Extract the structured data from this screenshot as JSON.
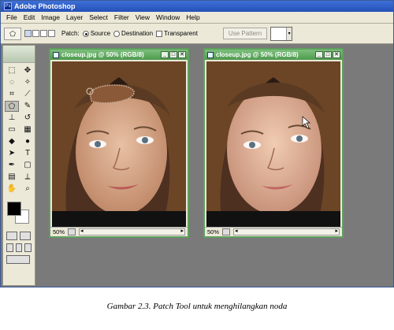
{
  "window": {
    "title": "Adobe Photoshop"
  },
  "menu": [
    "File",
    "Edit",
    "Image",
    "Layer",
    "Select",
    "Filter",
    "View",
    "Window",
    "Help"
  ],
  "options": {
    "patch_label": "Patch:",
    "source_label": "Source",
    "destination_label": "Destination",
    "transparent_label": "Transparent",
    "use_pattern_label": "Use Pattern",
    "patch_mode": "Source"
  },
  "documents": [
    {
      "title": "closeup.jpg @ 50% (RGB/8)",
      "zoom": "50%"
    },
    {
      "title": "closeup.jpg @ 50% (RGB/8)",
      "zoom": "50%"
    }
  ],
  "caption": "Gambar 2.3. Patch Tool untuk menghilangkan noda",
  "colors": {
    "foreground": "#000000",
    "background": "#ffffff",
    "doc_border": "#5fa05f"
  }
}
